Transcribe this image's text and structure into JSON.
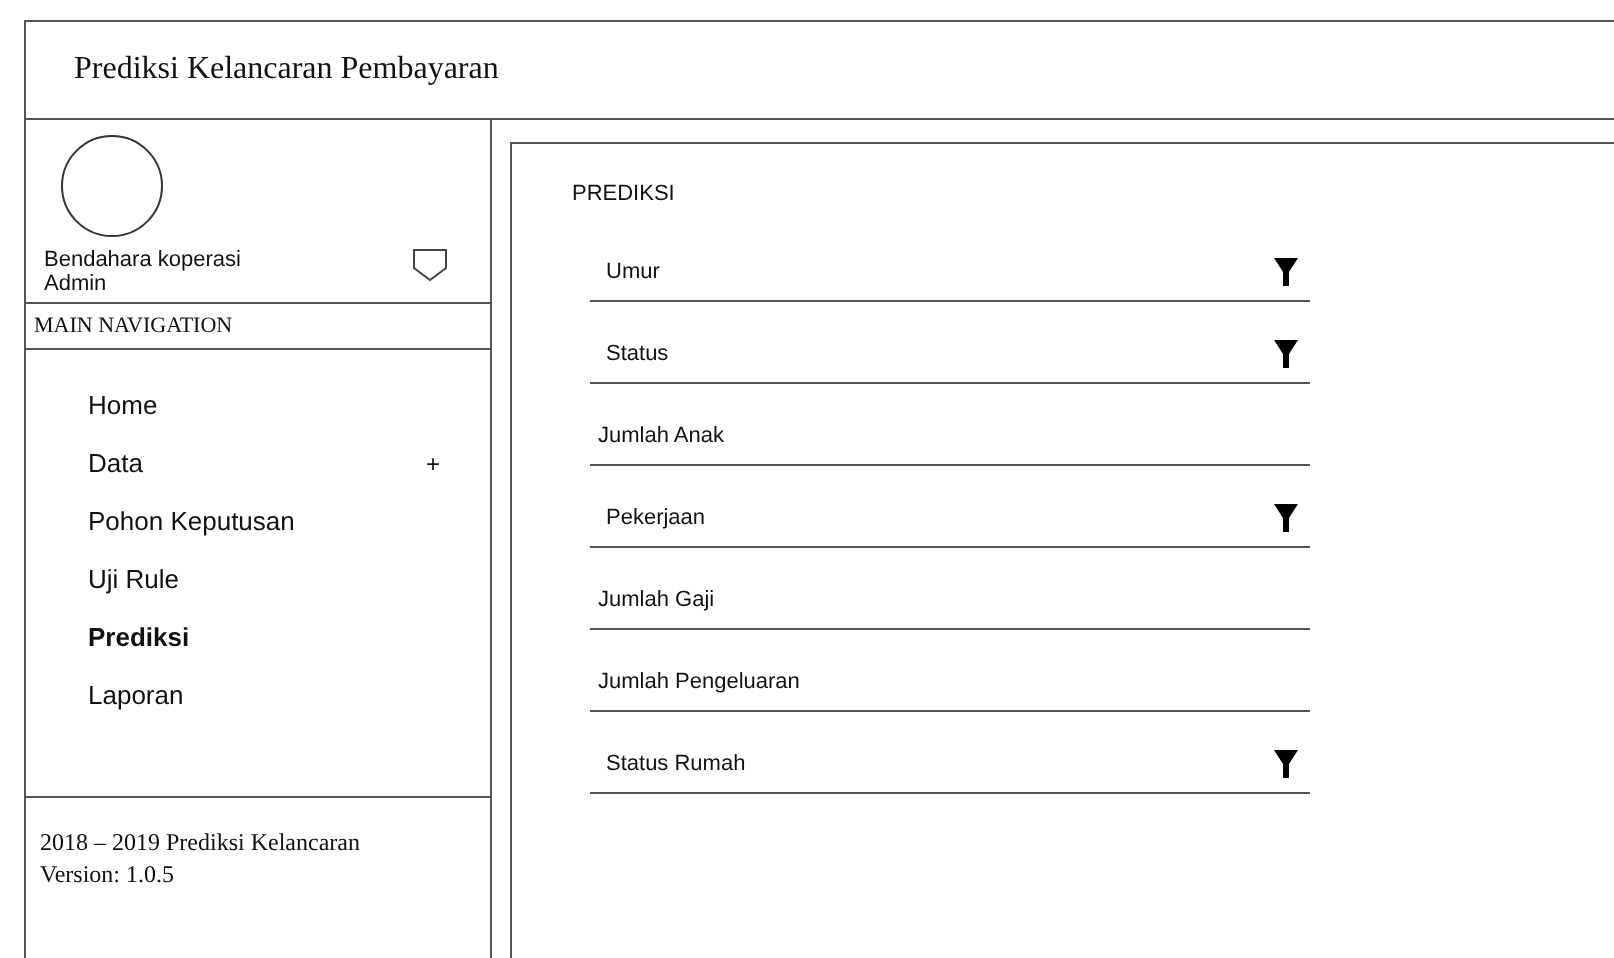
{
  "header": {
    "title": "Prediksi Kelancaran Pembayaran"
  },
  "user": {
    "name": "Bendahara koperasi",
    "role": "Admin"
  },
  "sidebar": {
    "heading": "MAIN NAVIGATION",
    "items": [
      {
        "label": "Home",
        "selected": false
      },
      {
        "label": "Data",
        "selected": false,
        "toggle": "+"
      },
      {
        "label": "Pohon Keputusan",
        "selected": false
      },
      {
        "label": "Uji Rule",
        "selected": false
      },
      {
        "label": "Prediksi",
        "selected": true
      },
      {
        "label": "Laporan",
        "selected": false
      }
    ]
  },
  "footer": {
    "lines": [
      "2018 – 2019 Prediksi Kelancaran",
      "Version: 1.0.5"
    ]
  },
  "form": {
    "title": "PREDIKSI",
    "fields": [
      {
        "kind": "select",
        "placeholder": "Umur"
      },
      {
        "kind": "select",
        "placeholder": "Status"
      },
      {
        "kind": "text",
        "placeholder": "Jumlah Anak"
      },
      {
        "kind": "select",
        "placeholder": "Pekerjaan"
      },
      {
        "kind": "text",
        "placeholder": "Jumlah Gaji"
      },
      {
        "kind": "text",
        "placeholder": "Jumlah Pengeluaran"
      },
      {
        "kind": "select",
        "placeholder": "Status Rumah"
      }
    ]
  }
}
